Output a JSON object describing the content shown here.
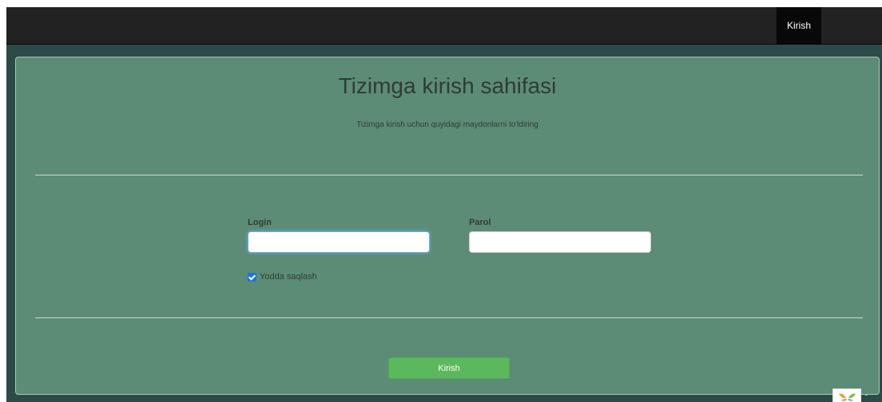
{
  "navbar": {
    "login_link": "Kirish"
  },
  "panel": {
    "title": "Tizimga kirish sahifasi",
    "subtitle": "Tizimga kirish uchun quyidagi maydonlarni to'ldiring"
  },
  "form": {
    "login_label": "Login",
    "login_value": "",
    "password_label": "Parol",
    "password_value": "",
    "remember_label": "Yodda saqlash",
    "remember_checked": true,
    "submit_label": "Kirish"
  },
  "colors": {
    "navbar": "#222222",
    "panel": "#5d8c76",
    "page_background": "#2c4a47",
    "submit_button": "#5cb85c",
    "checkbox": "#1a73e8"
  }
}
